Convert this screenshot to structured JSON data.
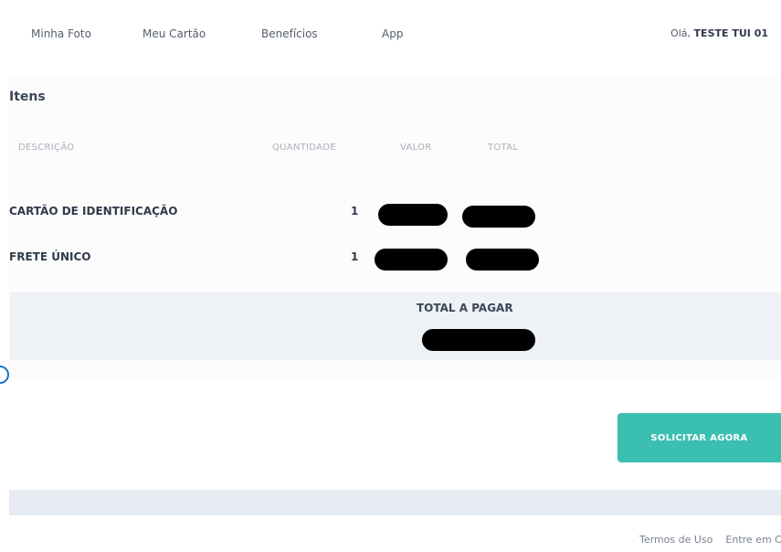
{
  "nav": {
    "items": [
      {
        "label": "Minha Foto"
      },
      {
        "label": "Meu Cartão"
      },
      {
        "label": "Benefícios"
      },
      {
        "label": "App"
      }
    ],
    "greeting_prefix": "Olá,",
    "user_name": "TESTE TUI 01"
  },
  "items_section": {
    "title": "Itens",
    "columns": {
      "description": "DESCRIÇÃO",
      "quantity": "QUANTIDADE",
      "value": "VALOR",
      "total": "TOTAL"
    },
    "rows": [
      {
        "description": "CARTÃO DE IDENTIFICAÇÃO",
        "quantity": "1"
      },
      {
        "description": "FRETE ÚNICO",
        "quantity": "1"
      }
    ],
    "total_label": "TOTAL A PAGAR"
  },
  "cta": {
    "label": "SOLICITAR AGORA"
  },
  "footer": {
    "links": [
      "Termos de Uso",
      "Entre em C"
    ]
  },
  "colors": {
    "accent": "#3bbfb1",
    "total_band": "#eef2f6",
    "footer_band": "#e6ebf2"
  }
}
